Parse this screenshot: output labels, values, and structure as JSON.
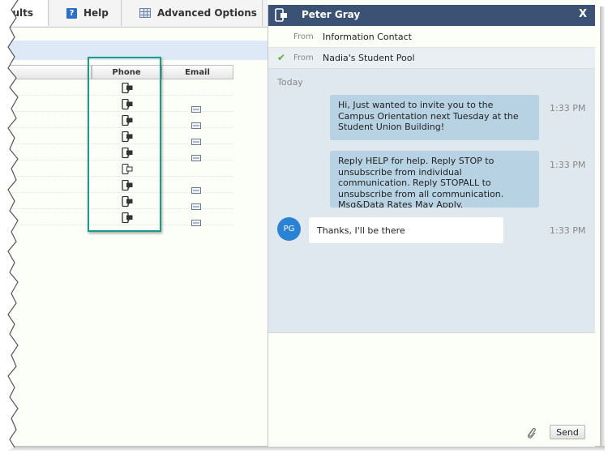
{
  "tabs": [
    {
      "label": "ults"
    },
    {
      "label": "Help",
      "icon": "help-icon"
    },
    {
      "label": "Advanced Options",
      "icon": "grid-icon"
    }
  ],
  "grid": {
    "columns": [
      "",
      "Phone",
      "Email"
    ],
    "rows": [
      {
        "phone": "phone-icon",
        "email": ""
      },
      {
        "phone": "phone-icon",
        "email": "email-icon"
      },
      {
        "phone": "phone-icon",
        "email": "email-icon"
      },
      {
        "phone": "phone-icon",
        "email": "email-icon"
      },
      {
        "phone": "phone-icon",
        "email": "email-icon"
      },
      {
        "phone": "phone-outline-icon",
        "email": ""
      },
      {
        "phone": "phone-icon",
        "email": "email-icon"
      },
      {
        "phone": "phone-icon",
        "email": "email-icon"
      },
      {
        "phone": "phone-icon",
        "email": "email-icon"
      }
    ]
  },
  "chat": {
    "contact_name": "Peter Gray",
    "close_label": "X",
    "from_label": "From",
    "from_options": [
      {
        "value": "Information Contact",
        "selected": false
      },
      {
        "value": "Nadia's Student Pool",
        "selected": true
      }
    ],
    "day_label": "Today",
    "messages": [
      {
        "text": "Hi, Just wanted to invite you to the Campus Orientation next Tuesday at the Student Union Building!",
        "time": "1:33 PM",
        "direction": "outgoing"
      },
      {
        "text": "Reply HELP for help. Reply STOP to unsubscribe from individual communication. Reply STOPALL to unsubscribe from all communication. Msg&Data Rates May Apply.",
        "time": "1:33 PM",
        "direction": "outgoing"
      },
      {
        "text": "Thanks, I'll be there",
        "time": "1:33 PM",
        "direction": "incoming",
        "avatar_initials": "PG"
      }
    ],
    "send_label": "Send"
  },
  "colors": {
    "header_bg": "#3b5275",
    "bubble_out": "#b7d2e3",
    "avatar": "#2a82d4",
    "highlight": "#1e9a8a",
    "check": "#5aab3a"
  }
}
